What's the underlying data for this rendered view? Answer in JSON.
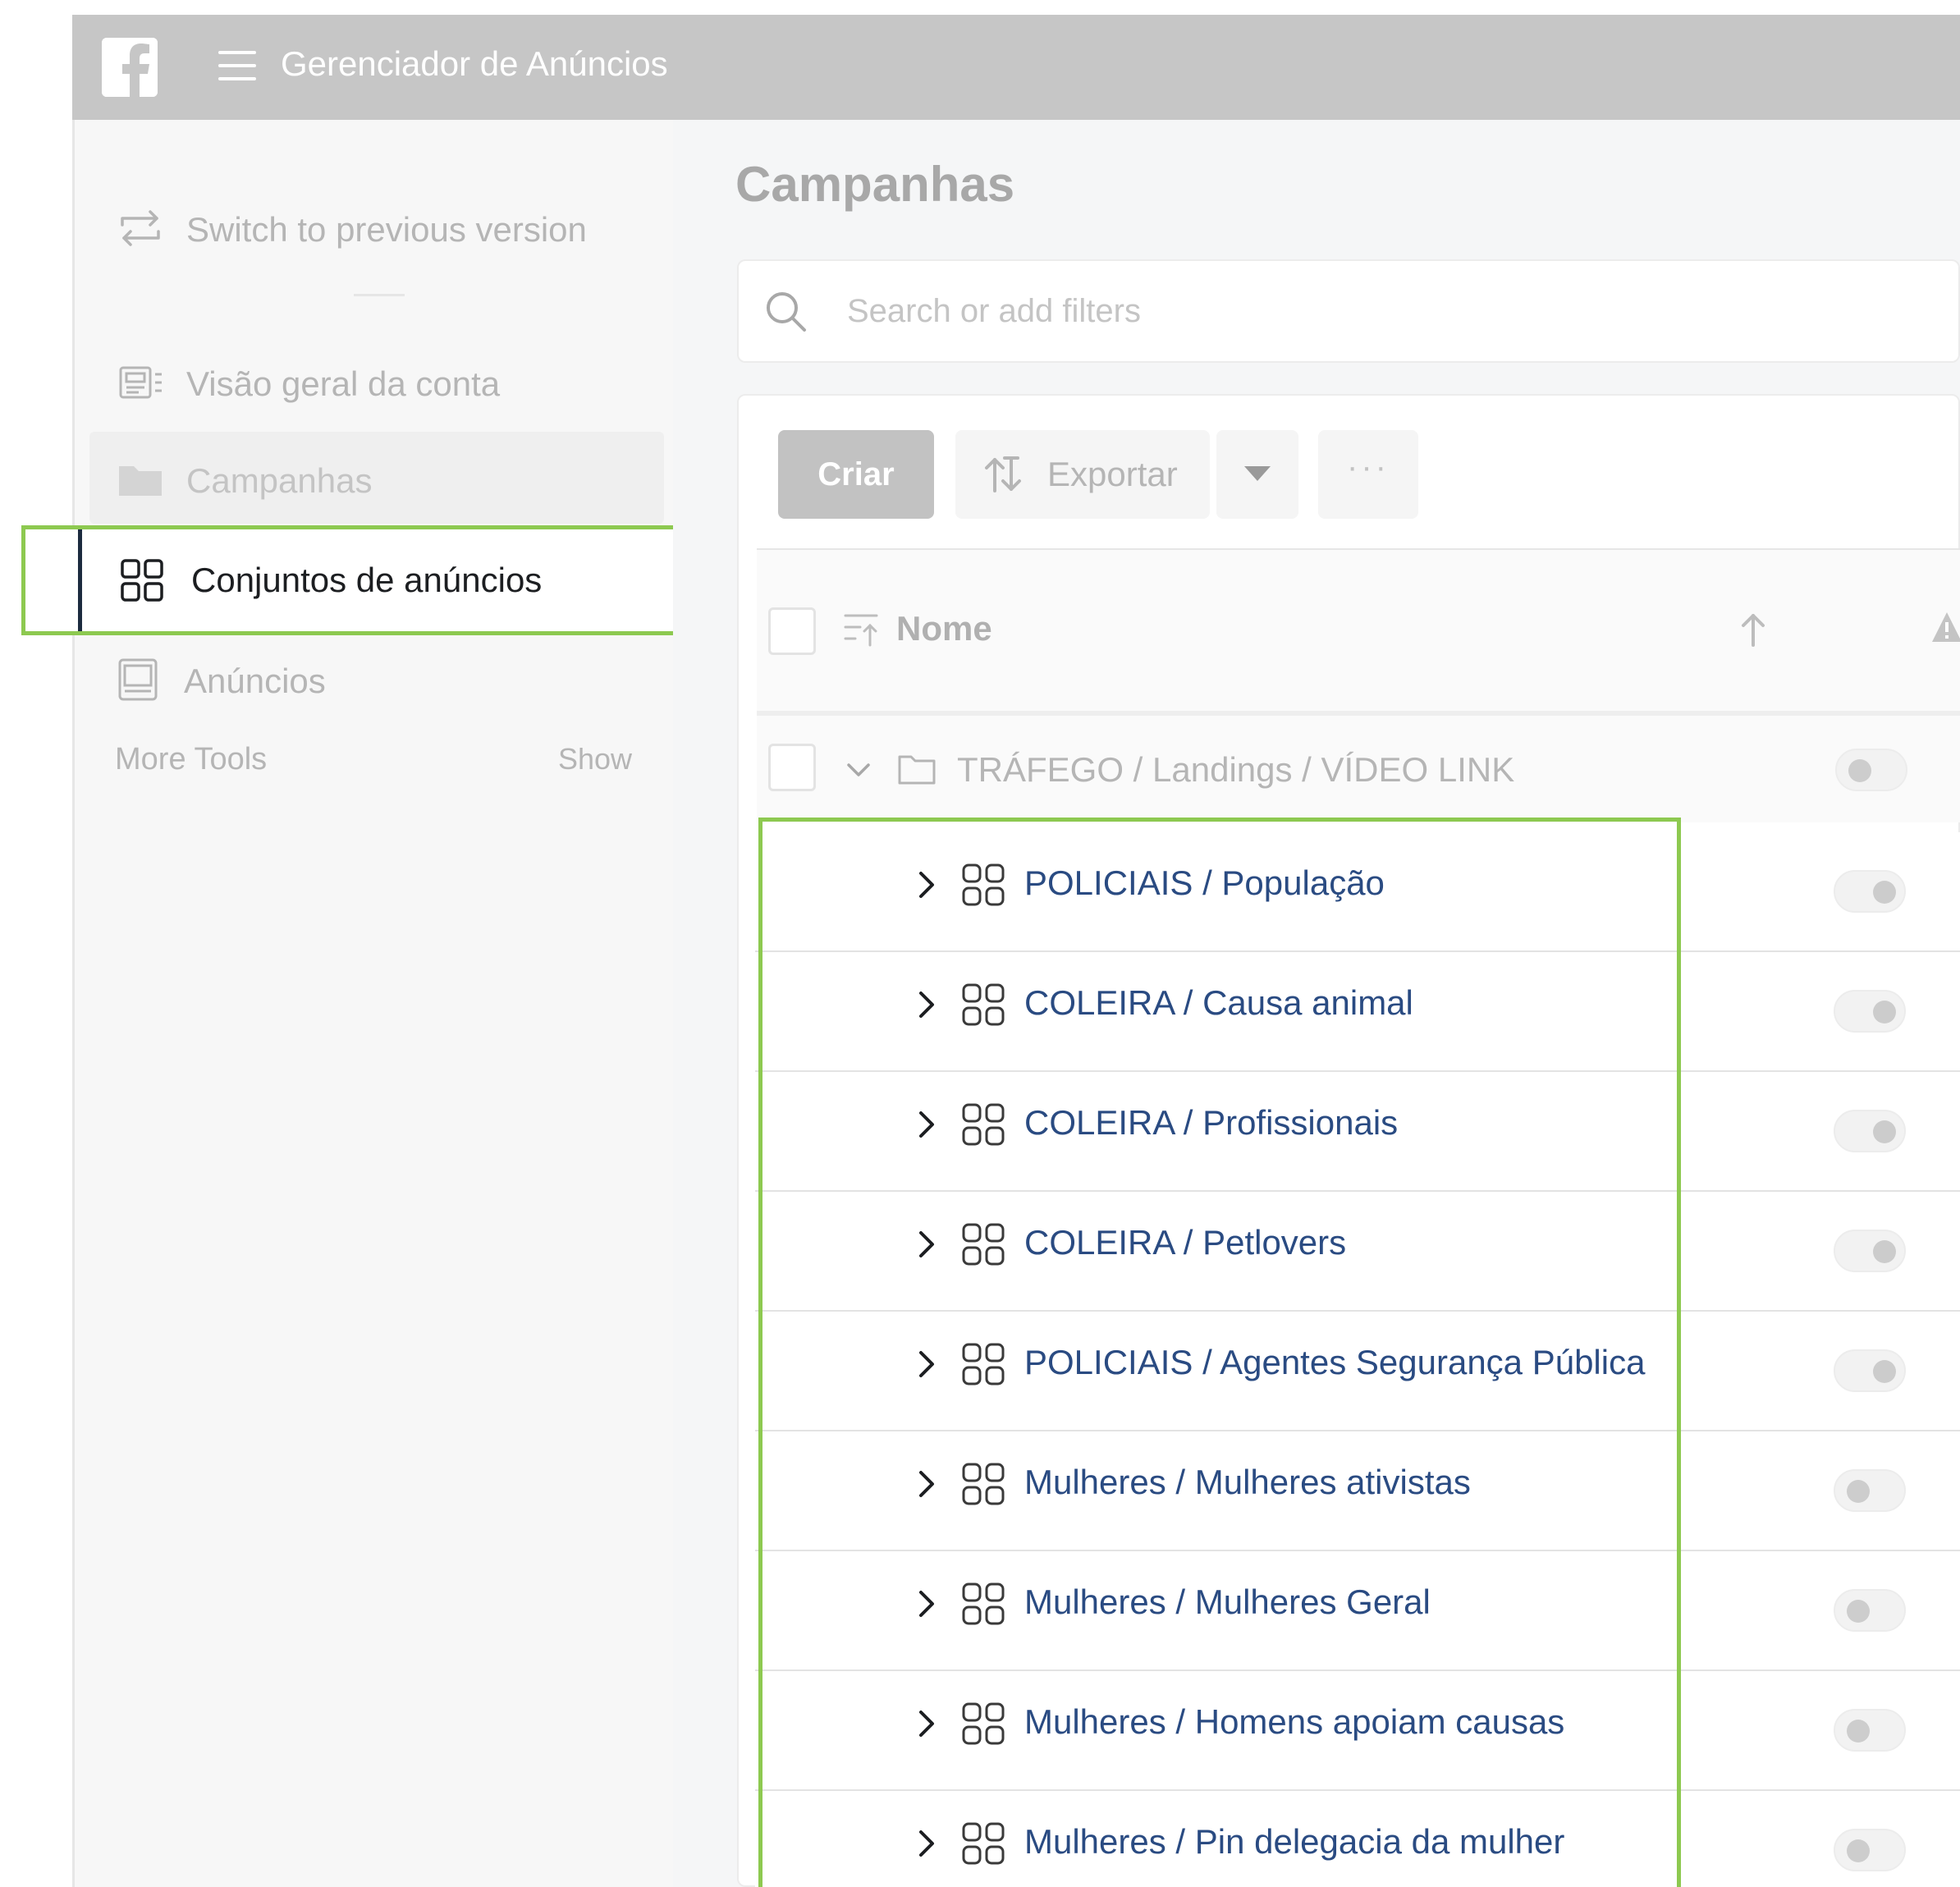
{
  "topbar": {
    "title": "Gerenciador de Anúncios",
    "logo_icon": "facebook-logo-icon",
    "menu_icon": "hamburger-icon",
    "background": "#c6c6c6"
  },
  "sidebar": {
    "switch_label": "Switch to previous version",
    "items": [
      {
        "label": "Visão geral da conta",
        "icon": "account-overview-icon"
      },
      {
        "label": "Campanhas",
        "icon": "folder-icon"
      },
      {
        "label": "Conjuntos de anúncios",
        "icon": "grid-icon",
        "active": true
      },
      {
        "label": "Anúncios",
        "icon": "ad-icon"
      }
    ],
    "more_tools": "More Tools",
    "show": "Show"
  },
  "main": {
    "title": "Campanhas",
    "search_placeholder": "Search or add filters",
    "toolbar": {
      "criar": "Criar",
      "exportar": "Exportar",
      "more": "···"
    },
    "table": {
      "column_name": "Nome"
    },
    "campaign": {
      "name": "TRÁFEGO / Landings / VÍDEO LINK",
      "toggle_on": false
    },
    "adsets": [
      {
        "name": "POLICIAIS / População",
        "toggle_on": true
      },
      {
        "name": "COLEIRA / Causa animal",
        "toggle_on": true
      },
      {
        "name": "COLEIRA / Profissionais",
        "toggle_on": true
      },
      {
        "name": "COLEIRA / Petlovers",
        "toggle_on": true
      },
      {
        "name": "POLICIAIS / Agentes Segurança Pública",
        "toggle_on": true
      },
      {
        "name": "Mulheres / Mulheres ativistas",
        "toggle_on": false
      },
      {
        "name": "Mulheres / Mulheres Geral",
        "toggle_on": false
      },
      {
        "name": "Mulheres / Homens apoiam causas",
        "toggle_on": false
      },
      {
        "name": "Mulheres / Pin delegacia da mulher",
        "toggle_on": false
      }
    ]
  },
  "colors": {
    "highlight": "#8dc950",
    "link": "#2a4b82",
    "muted": "#b5b5b5"
  }
}
